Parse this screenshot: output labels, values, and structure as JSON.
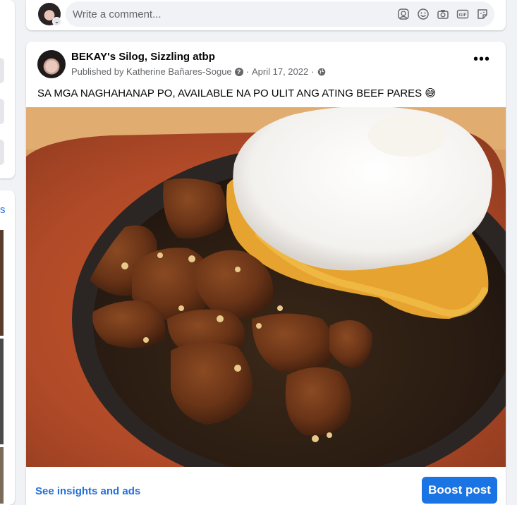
{
  "comment_bar": {
    "placeholder": "Write a comment...",
    "icons": [
      "avatar-sticker-icon",
      "emoji-icon",
      "camera-icon",
      "gif-icon",
      "sticker-icon"
    ]
  },
  "post": {
    "page_name": "BEKAY's Silog, Sizzling atbp",
    "published_by": "Published by Katherine Bañares-Sogue",
    "separator": "·",
    "date": "April 17, 2022",
    "text": "SA MGA NAGHAHANAP PO, AVAILABLE NA PO ULIT ANG ATING BEEF PARES",
    "emoji": "😅",
    "more_label": "•••",
    "photo_icon": "beef-pares-sizzling-plate-photo"
  },
  "footer": {
    "insights_label": "See insights and ads",
    "boost_label": "Boost post"
  },
  "sidebar": {
    "partial_text": "s"
  },
  "colors": {
    "link": "#216fdb",
    "boost": "#1b74e4",
    "background": "#f0f2f5"
  }
}
